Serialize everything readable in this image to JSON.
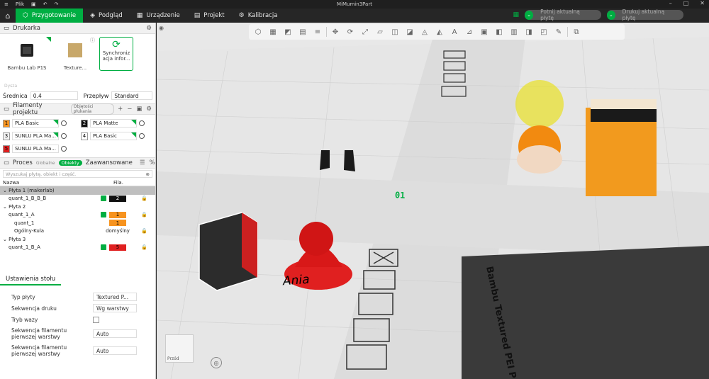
{
  "titlebar": {
    "menu": "Plik",
    "title": "MiMumin3Part"
  },
  "nav": {
    "tabs": [
      {
        "label": "Przygotowanie",
        "active": true,
        "icon": "cube-icon"
      },
      {
        "label": "Podgląd",
        "icon": "layers-icon"
      },
      {
        "label": "Urządzenie",
        "icon": "device-icon"
      },
      {
        "label": "Projekt",
        "icon": "project-icon"
      },
      {
        "label": "Kalibracja",
        "icon": "calibration-icon"
      }
    ],
    "slice_button": "Potnij aktualną płytę",
    "print_button": "Drukuj aktualną płytę"
  },
  "printer": {
    "section_title": "Drukarka",
    "printer_name": "Bambu Lab P1S",
    "plate_name": "Texture...",
    "sync_label": "Synchroniz acja infor...",
    "small_label": "Dysza",
    "diameter_label": "Średnica",
    "diameter_value": "0.4",
    "flow_label": "Przepływ",
    "flow_value": "Standard"
  },
  "filaments": {
    "section_title": "Filamenty projektu",
    "flush_button": "Objętości płukania",
    "items": [
      {
        "num": "1",
        "name": "PLA Basic",
        "color": "#f7931e"
      },
      {
        "num": "2",
        "name": "PLA Matte",
        "color": "#111111"
      },
      {
        "num": "3",
        "name": "SUNLU PLA Ma...",
        "color": "#f2f2f2"
      },
      {
        "num": "4",
        "name": "PLA Basic",
        "color": "#ffffff"
      },
      {
        "num": "5",
        "name": "SUNLU PLA Ma...",
        "color": "#e02020"
      }
    ]
  },
  "process": {
    "section_title": "Proces",
    "global_label": "Globalne",
    "objects_label": "Obiekty",
    "advanced_label": "Zaawansowane",
    "search_placeholder": "Wyszukaj płytę, obiekt i część.",
    "col_name": "Nazwa",
    "col_fil": "Fila.",
    "rows": [
      {
        "name": "Płyta 1 (makerlab)",
        "indent": 0,
        "sel": true
      },
      {
        "name": "quant_1_B_B_B",
        "indent": 1,
        "fil": "2",
        "filcolor": "#111111",
        "check": true,
        "lock": true
      },
      {
        "name": "Płyta 2",
        "indent": 0
      },
      {
        "name": "quant_1_A",
        "indent": 1,
        "fil": "1",
        "filcolor": "#f7931e",
        "check": true,
        "lock": true
      },
      {
        "name": "quant_1",
        "indent": 2,
        "fil": "1",
        "filcolor": "#f7931e"
      },
      {
        "name": "Ogólny-Kula",
        "indent": 2,
        "fil": "domyślny",
        "lock": true
      },
      {
        "name": "Płyta 3",
        "indent": 0
      },
      {
        "name": "quant_1_B_A",
        "indent": 1,
        "fil": "5",
        "filcolor": "#e02020",
        "check": true,
        "lock": true
      }
    ]
  },
  "table_settings": {
    "tab_label": "Ustawienia stołu",
    "rows": [
      {
        "label": "Typ płyty",
        "value": "Textured P..."
      },
      {
        "label": "Sekwencja druku",
        "value": "Wg warstwy"
      },
      {
        "label": "Tryb wazy",
        "value": ""
      },
      {
        "label": "Sekwencja filamentu pierwszej warstwy",
        "value": "Auto"
      },
      {
        "label": "Sekwencja filamentu pierwszej warstwy",
        "value": "Auto"
      }
    ]
  },
  "viewport": {
    "plate_number": "01",
    "plate_text": "Bambu Textured PEI P",
    "label_text": "Ania",
    "view_cube_label": "Przód"
  },
  "colors": {
    "accent": "#00ae42",
    "orange": "#f7931e",
    "red": "#e02020"
  }
}
